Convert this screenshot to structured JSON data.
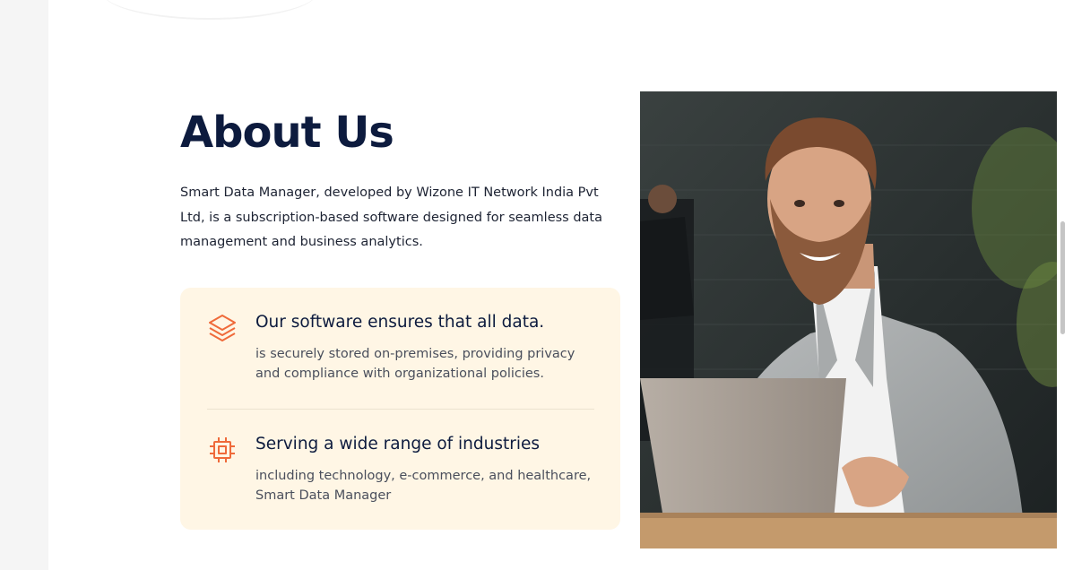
{
  "about": {
    "title": "About Us",
    "description": "Smart Data Manager, developed by Wizone IT Network India Pvt Ltd, is a subscription-based software designed for seamless data management and business analytics."
  },
  "features": [
    {
      "icon": "layers-icon",
      "heading": "Our software ensures that all data.",
      "text": "is securely stored on-premises, providing privacy and compliance with organizational policies."
    },
    {
      "icon": "chip-icon",
      "heading": "Serving a wide range of industries",
      "text": "including technology, e-commerce, and healthcare, Smart Data Manager"
    }
  ],
  "colors": {
    "title": "#0d1b3e",
    "accent": "#ef6a3a",
    "card_background": "#fff6e5"
  }
}
